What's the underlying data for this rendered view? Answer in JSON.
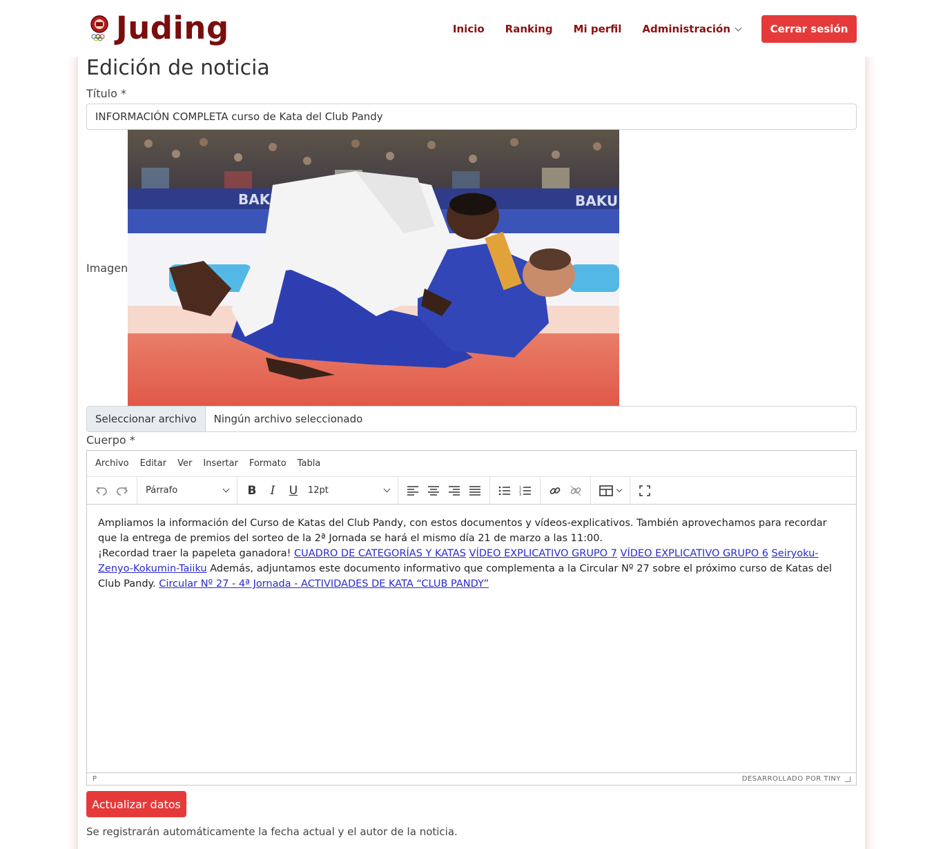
{
  "brand": {
    "name": "Juding",
    "logo_icon": "club-emblem-icon"
  },
  "nav": {
    "items": [
      "Inicio",
      "Ranking",
      "Mi perfil",
      "Administración"
    ],
    "logout_label": "Cerrar sesión"
  },
  "colors": {
    "brand": "#7a0d0d",
    "nav_link": "#8b1010",
    "accent": "#e63a3a",
    "link": "#2a2acd"
  },
  "page": {
    "title": "Edición de noticia"
  },
  "form": {
    "title_label": "Título *",
    "title_value": "INFORMACIÓN COMPLETA curso de Kata del Club Pandy",
    "image_label": "Imagen",
    "file_button": "Seleccionar archivo",
    "file_status": "Ningún archivo seleccionado",
    "body_label": "Cuerpo *",
    "submit_label": "Actualizar datos",
    "note": "Se registrarán automáticamente la fecha actual y el autor de la noticia."
  },
  "photo_banners": [
    "BAKU",
    "BAKU"
  ],
  "editor": {
    "menu": [
      "Archivo",
      "Editar",
      "Ver",
      "Insertar",
      "Formato",
      "Tabla"
    ],
    "block_format": "Párrafo",
    "font_size": "12pt",
    "body": {
      "p1": "Ampliamos la información del Curso de Katas del Club Pandy, con estos documentos y vídeos-explicativos. También aprovechamos para recordar que la entrega de premios del sorteo de la 2ª Jornada se hará el mismo día 21 de marzo a las 11:00.",
      "p2_lead": "¡Recordad traer la papeleta ganadora!",
      "link1": "CUADRO DE CATEGORÍAS Y KATAS",
      "link2": "VÍDEO EXPLICATIVO GRUPO 7",
      "link3": "VÍDEO EXPLICATIVO GRUPO 6",
      "link4": "Seiryoku-Zenyo-Kokumin-Taiiku",
      "p2_tail": "Además, adjuntamos este documento informativo que complementa a la Circular Nº 27 sobre el próximo curso de Katas del Club Pandy.",
      "link5": "Circular Nº 27 - 4ª Jornada - ACTIVIDADES DE KATA “CLUB PANDY”"
    },
    "status_path": "P",
    "powered_by": "DESARROLLADO POR TINY"
  }
}
